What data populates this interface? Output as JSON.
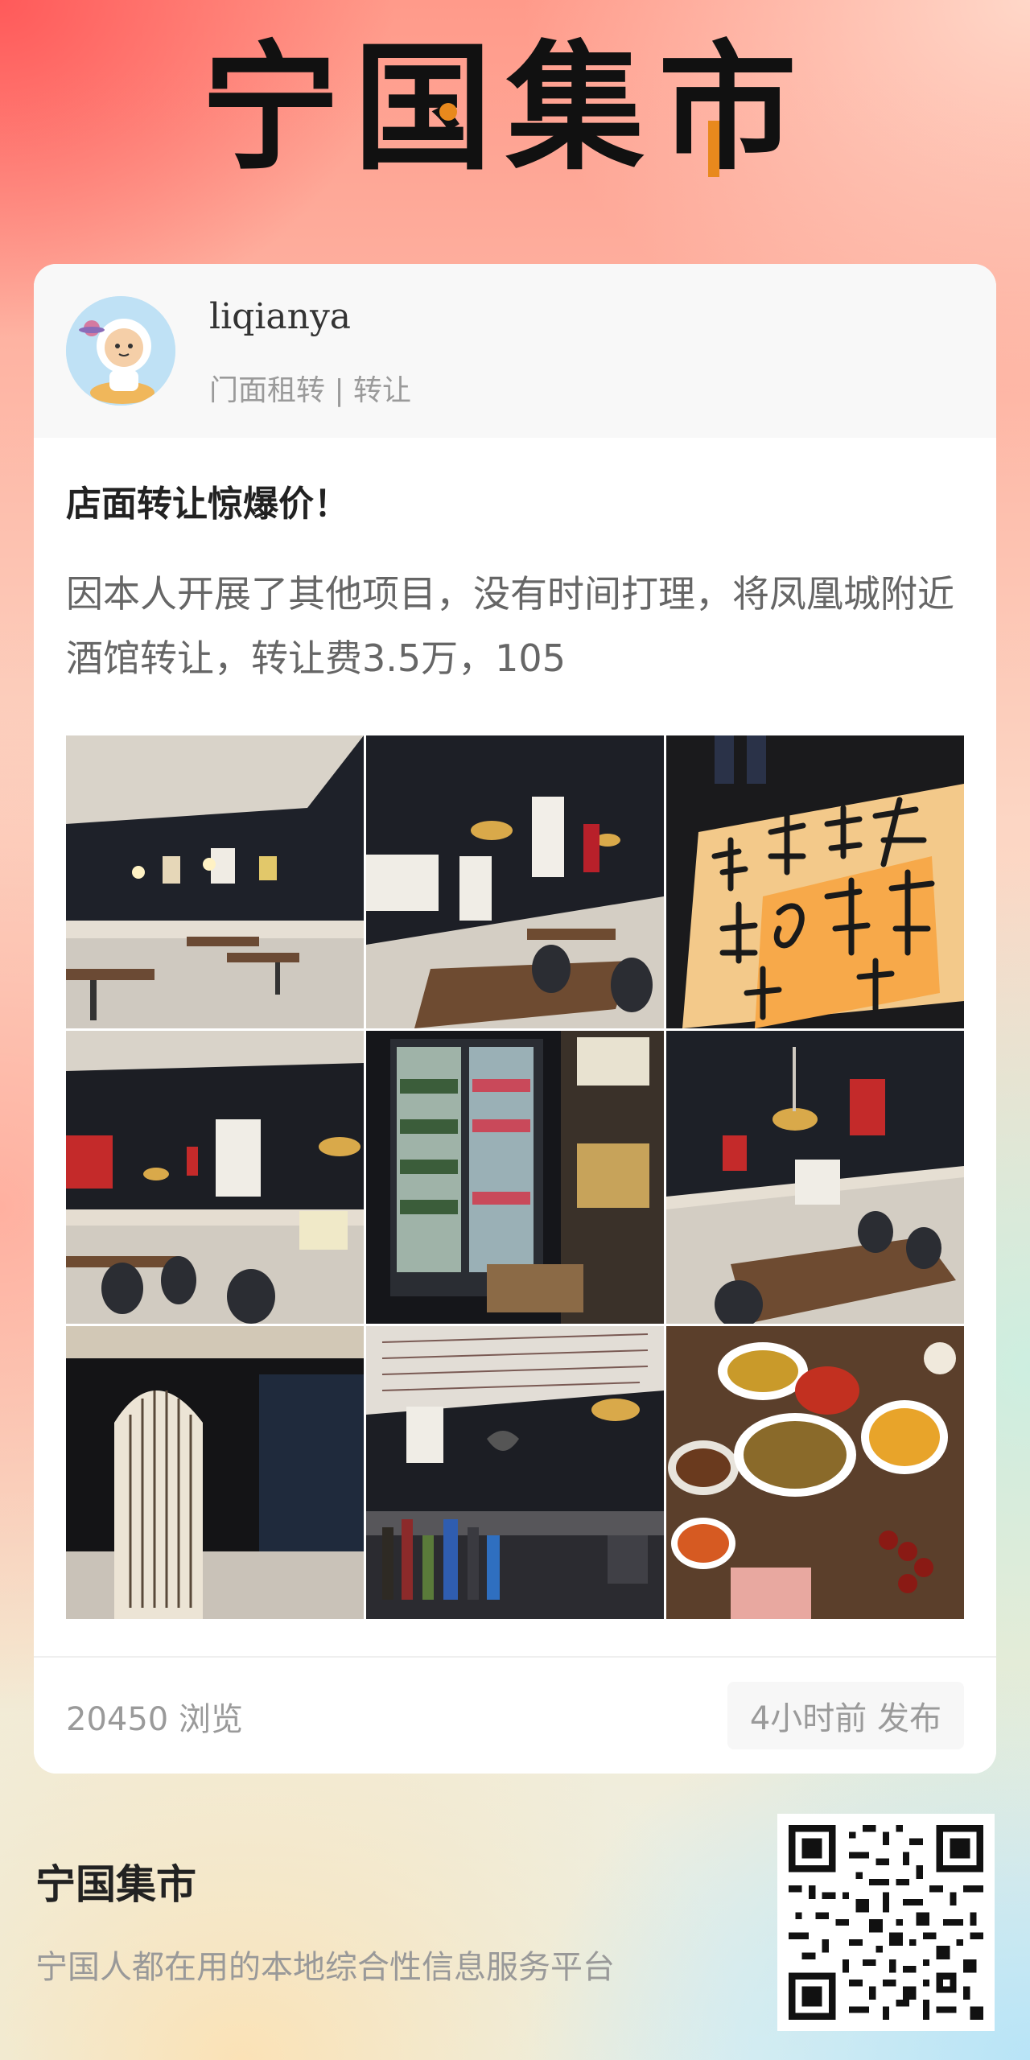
{
  "brand": {
    "logo_chars": [
      "宁",
      "国",
      "集",
      "市"
    ]
  },
  "post": {
    "username": "liqianya",
    "category": "门面租转 | 转让",
    "title": "店面转让惊爆价！",
    "body": "因本人开展了其他项目，没有时间打理，将凤凰城附近酒馆转让，转让费3.5万，105",
    "views": "20450 浏览",
    "posted": "4小时前 发布",
    "photos": [
      "bar-interior-wall-posters",
      "bar-tables-lamps",
      "calligraphy-wall-poster",
      "dark-wall-dining-area",
      "drinks-fridge",
      "dining-corner-lamp",
      "calligraphy-arch-doorway",
      "bar-counter-bottles",
      "food-dishes-table"
    ]
  },
  "footer": {
    "title": "宁国集市",
    "subtitle": "宁国人都在用的本地综合性信息服务平台"
  },
  "colors": {
    "accent": "#e8891d",
    "card": "#ffffff",
    "muted_text": "#9a9a9a"
  }
}
